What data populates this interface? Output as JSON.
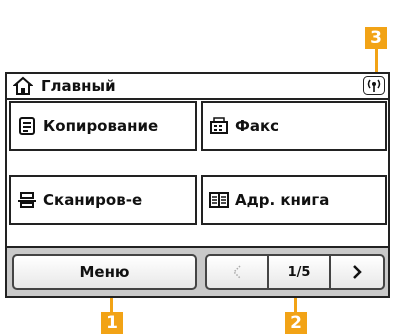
{
  "header": {
    "title": "Главный",
    "home_icon": "home-icon",
    "status_icon": "wireless-icon"
  },
  "buttons": [
    {
      "label": "Копирование",
      "icon": "copy-icon"
    },
    {
      "label": "Факс",
      "icon": "fax-icon"
    },
    {
      "label": "Сканиров-е",
      "icon": "scan-icon"
    },
    {
      "label": "Адр. книга",
      "icon": "address-book-icon"
    }
  ],
  "bottom": {
    "menu_label": "Меню",
    "page_indicator": "1/5"
  },
  "callouts": {
    "c1": "1",
    "c2": "2",
    "c3": "3"
  },
  "colors": {
    "callout": "#f2a316",
    "bar": "#c9c9c9",
    "border": "#222222"
  }
}
